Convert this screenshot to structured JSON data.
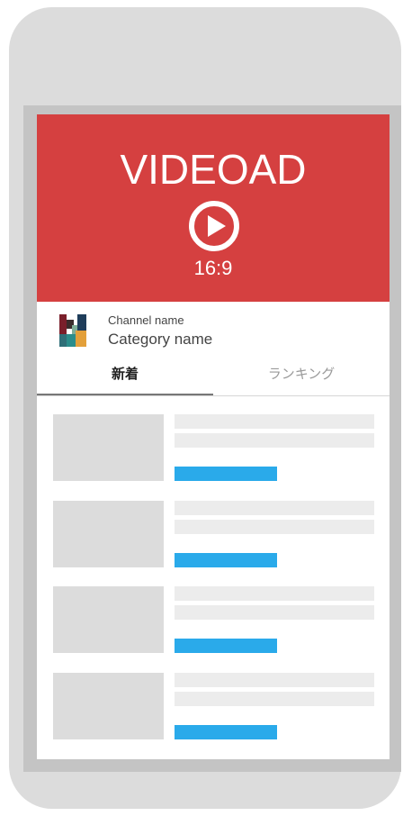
{
  "ad": {
    "title": "VIDEOAD",
    "ratio": "16:9",
    "icon": "play-circle-icon",
    "background": "#d54040"
  },
  "channel": {
    "name": "Channel name",
    "category": "Category name",
    "icon": "channel-logo-icon"
  },
  "tabs": [
    {
      "label": "新着",
      "active": true
    },
    {
      "label": "ランキング",
      "active": false
    }
  ],
  "list": {
    "count": 4,
    "accent": "#2aaaea",
    "placeholder": "#dcdcdc"
  }
}
